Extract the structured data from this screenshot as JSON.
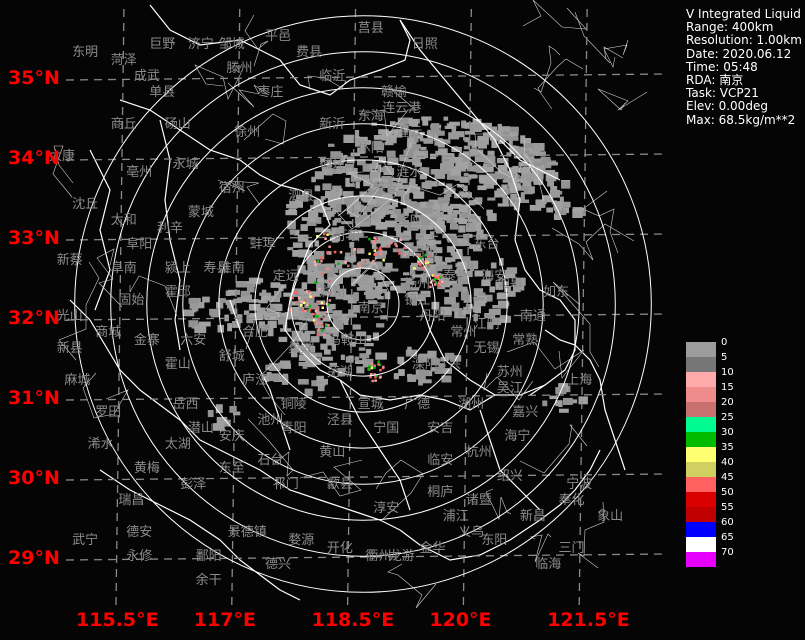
{
  "info": {
    "product": "V Integrated Liquid",
    "range": "Range: 400km",
    "resolution": "Resolution: 1.00km",
    "date": "Date: 2020.06.12",
    "time": "Time: 05:48",
    "rda": "RDA: 南京",
    "task": "Task: VCP21",
    "elev": "Elev: 0.00deg",
    "max": "Max: 68.5kg/m**2"
  },
  "lat_labels": [
    {
      "text": "35°N",
      "lat": 35
    },
    {
      "text": "34°N",
      "lat": 34
    },
    {
      "text": "33°N",
      "lat": 33
    },
    {
      "text": "32°N",
      "lat": 32
    },
    {
      "text": "31°N",
      "lat": 31
    },
    {
      "text": "30°N",
      "lat": 30
    },
    {
      "text": "29°N",
      "lat": 29
    }
  ],
  "lon_labels": [
    {
      "text": "115.5°E",
      "lon": 115.5
    },
    {
      "text": "117°E",
      "lon": 117
    },
    {
      "text": "118.5°E",
      "lon": 118.5
    },
    {
      "text": "120°E",
      "lon": 120
    },
    {
      "text": "121.5°E",
      "lon": 121.5
    }
  ],
  "legend": [
    {
      "label": "0",
      "color": "#9c9c9c"
    },
    {
      "label": "5",
      "color": "#767676"
    },
    {
      "label": "10",
      "color": "#ffaaaa"
    },
    {
      "label": "15",
      "color": "#ee8c8c"
    },
    {
      "label": "20",
      "color": "#c97070"
    },
    {
      "label": "25",
      "color": "#00fb90"
    },
    {
      "label": "30",
      "color": "#00bb00"
    },
    {
      "label": "35",
      "color": "#ffff70"
    },
    {
      "label": "40",
      "color": "#d0d060"
    },
    {
      "label": "45",
      "color": "#ff6060"
    },
    {
      "label": "50",
      "color": "#da0000"
    },
    {
      "label": "55",
      "color": "#c00000"
    },
    {
      "label": "60",
      "color": "#0000ff"
    },
    {
      "label": "65",
      "color": "#ffffff"
    },
    {
      "label": "70",
      "color": "#e800ff"
    }
  ],
  "radar": {
    "name": "南京",
    "lon": 118.7,
    "lat": 32.2,
    "ring_count": 8,
    "ring_spacing_km": 50
  },
  "cities": [
    {
      "name": "东明",
      "lon": 115.1,
      "lat": 35.3
    },
    {
      "name": "菏泽",
      "lon": 115.6,
      "lat": 35.2
    },
    {
      "name": "巨野",
      "lon": 116.1,
      "lat": 35.4
    },
    {
      "name": "济宁",
      "lon": 116.6,
      "lat": 35.4
    },
    {
      "name": "邹城",
      "lon": 117.0,
      "lat": 35.4
    },
    {
      "name": "平邑",
      "lon": 117.6,
      "lat": 35.5
    },
    {
      "name": "费县",
      "lon": 118.0,
      "lat": 35.3
    },
    {
      "name": "莒县",
      "lon": 118.8,
      "lat": 35.6
    },
    {
      "name": "日照",
      "lon": 119.5,
      "lat": 35.4
    },
    {
      "name": "成武",
      "lon": 115.9,
      "lat": 35.0
    },
    {
      "name": "单县",
      "lon": 116.1,
      "lat": 34.8
    },
    {
      "name": "滕州",
      "lon": 117.1,
      "lat": 35.1
    },
    {
      "name": "枣庄",
      "lon": 117.5,
      "lat": 34.8
    },
    {
      "name": "临沂",
      "lon": 118.3,
      "lat": 35.0
    },
    {
      "name": "赣榆",
      "lon": 119.1,
      "lat": 34.8
    },
    {
      "name": "砀山",
      "lon": 116.3,
      "lat": 34.4
    },
    {
      "name": "徐州",
      "lon": 117.2,
      "lat": 34.3
    },
    {
      "name": "新沂",
      "lon": 118.3,
      "lat": 34.4
    },
    {
      "name": "东海",
      "lon": 118.8,
      "lat": 34.5
    },
    {
      "name": "连云港",
      "lon": 119.2,
      "lat": 34.6
    },
    {
      "name": "商丘",
      "lon": 115.6,
      "lat": 34.4
    },
    {
      "name": "永城",
      "lon": 116.4,
      "lat": 33.9
    },
    {
      "name": "宿州",
      "lon": 117.0,
      "lat": 33.6
    },
    {
      "name": "宿迁",
      "lon": 118.3,
      "lat": 33.9
    },
    {
      "name": "沭阳",
      "lon": 118.8,
      "lat": 34.1
    },
    {
      "name": "灌云",
      "lon": 119.3,
      "lat": 34.3
    },
    {
      "name": "太康",
      "lon": 114.8,
      "lat": 34.0
    },
    {
      "name": "亳州",
      "lon": 115.8,
      "lat": 33.8
    },
    {
      "name": "蒙城",
      "lon": 116.6,
      "lat": 33.3
    },
    {
      "name": "泗县",
      "lon": 117.9,
      "lat": 33.5
    },
    {
      "name": "淮安",
      "lon": 119.0,
      "lat": 33.6
    },
    {
      "name": "涟水",
      "lon": 119.3,
      "lat": 33.8
    },
    {
      "name": "沈丘",
      "lon": 115.1,
      "lat": 33.4
    },
    {
      "name": "太和",
      "lon": 115.6,
      "lat": 33.2
    },
    {
      "name": "利辛",
      "lon": 116.2,
      "lat": 33.1
    },
    {
      "name": "蚌埠",
      "lon": 117.4,
      "lat": 32.9
    },
    {
      "name": "盱眙",
      "lon": 118.5,
      "lat": 33.0
    },
    {
      "name": "宝应",
      "lon": 119.3,
      "lat": 33.2
    },
    {
      "name": "阜阳",
      "lon": 115.8,
      "lat": 32.9
    },
    {
      "name": "颍上",
      "lon": 116.3,
      "lat": 32.6
    },
    {
      "name": "淮南",
      "lon": 117.0,
      "lat": 32.6
    },
    {
      "name": "滁州",
      "lon": 118.3,
      "lat": 32.3
    },
    {
      "name": "高邮",
      "lon": 119.5,
      "lat": 32.8
    },
    {
      "name": "东台",
      "lon": 120.3,
      "lat": 32.9
    },
    {
      "name": "新蔡",
      "lon": 114.9,
      "lat": 32.7
    },
    {
      "name": "阜南",
      "lon": 115.6,
      "lat": 32.6
    },
    {
      "name": "寿县",
      "lon": 116.8,
      "lat": 32.6
    },
    {
      "name": "定远",
      "lon": 117.7,
      "lat": 32.5
    },
    {
      "name": "扬州",
      "lon": 119.4,
      "lat": 32.4
    },
    {
      "name": "泰州",
      "lon": 119.9,
      "lat": 32.5
    },
    {
      "name": "海安",
      "lon": 120.4,
      "lat": 32.5
    },
    {
      "name": "如皋",
      "lon": 120.6,
      "lat": 32.4
    },
    {
      "name": "光山",
      "lon": 114.9,
      "lat": 32.0
    },
    {
      "name": "固始",
      "lon": 115.7,
      "lat": 32.2
    },
    {
      "name": "霍邱",
      "lon": 116.3,
      "lat": 32.3
    },
    {
      "name": "合肥",
      "lon": 117.3,
      "lat": 31.8
    },
    {
      "name": "南京",
      "lon": 118.8,
      "lat": 32.1
    },
    {
      "name": "镇江",
      "lon": 119.4,
      "lat": 32.2
    },
    {
      "name": "丹阳",
      "lon": 119.6,
      "lat": 32.0
    },
    {
      "name": "南通",
      "lon": 120.9,
      "lat": 32.0
    },
    {
      "name": "如东",
      "lon": 121.2,
      "lat": 32.3
    },
    {
      "name": "商城",
      "lon": 115.4,
      "lat": 31.8
    },
    {
      "name": "六安",
      "lon": 116.5,
      "lat": 31.7
    },
    {
      "name": "巢湖",
      "lon": 117.9,
      "lat": 31.6
    },
    {
      "name": "马鞍山",
      "lon": 118.5,
      "lat": 31.7
    },
    {
      "name": "常州",
      "lon": 120.0,
      "lat": 31.8
    },
    {
      "name": "江阴",
      "lon": 120.3,
      "lat": 31.9
    },
    {
      "name": "新县",
      "lon": 114.9,
      "lat": 31.6
    },
    {
      "name": "金寨",
      "lon": 115.9,
      "lat": 31.7
    },
    {
      "name": "舒城",
      "lon": 117.0,
      "lat": 31.5
    },
    {
      "name": "芜湖",
      "lon": 118.4,
      "lat": 31.3
    },
    {
      "name": "溧阳",
      "lon": 119.5,
      "lat": 31.4
    },
    {
      "name": "无锡",
      "lon": 120.3,
      "lat": 31.6
    },
    {
      "name": "常熟",
      "lon": 120.8,
      "lat": 31.7
    },
    {
      "name": "霍山",
      "lon": 116.3,
      "lat": 31.4
    },
    {
      "name": "庐江",
      "lon": 117.3,
      "lat": 31.2
    },
    {
      "name": "宣城",
      "lon": 118.8,
      "lat": 30.9
    },
    {
      "name": "宜兴",
      "lon": 119.8,
      "lat": 31.4
    },
    {
      "name": "苏州",
      "lon": 120.6,
      "lat": 31.3
    },
    {
      "name": "上海",
      "lon": 121.5,
      "lat": 31.2
    },
    {
      "name": "麻城",
      "lon": 115.0,
      "lat": 31.2
    },
    {
      "name": "岳西",
      "lon": 116.4,
      "lat": 30.9
    },
    {
      "name": "铜陵",
      "lon": 117.8,
      "lat": 30.9
    },
    {
      "name": "广德",
      "lon": 119.4,
      "lat": 30.9
    },
    {
      "name": "湖州",
      "lon": 120.1,
      "lat": 30.9
    },
    {
      "name": "吴江",
      "lon": 120.6,
      "lat": 31.1
    },
    {
      "name": "罗田",
      "lon": 115.4,
      "lat": 30.8
    },
    {
      "name": "潜山",
      "lon": 116.6,
      "lat": 30.6
    },
    {
      "name": "池州",
      "lon": 117.5,
      "lat": 30.7
    },
    {
      "name": "泾县",
      "lon": 118.4,
      "lat": 30.7
    },
    {
      "name": "安吉",
      "lon": 119.7,
      "lat": 30.6
    },
    {
      "name": "嘉兴",
      "lon": 120.8,
      "lat": 30.8
    },
    {
      "name": "浠水",
      "lon": 115.3,
      "lat": 30.4
    },
    {
      "name": "太湖",
      "lon": 116.3,
      "lat": 30.4
    },
    {
      "name": "安庆",
      "lon": 117.0,
      "lat": 30.5
    },
    {
      "name": "青阳",
      "lon": 117.8,
      "lat": 30.6
    },
    {
      "name": "宁国",
      "lon": 119.0,
      "lat": 30.6
    },
    {
      "name": "杭州",
      "lon": 120.2,
      "lat": 30.3
    },
    {
      "name": "海宁",
      "lon": 120.7,
      "lat": 30.5
    },
    {
      "name": "黄梅",
      "lon": 115.9,
      "lat": 30.1
    },
    {
      "name": "东至",
      "lon": 117.0,
      "lat": 30.1
    },
    {
      "name": "石台",
      "lon": 117.5,
      "lat": 30.2
    },
    {
      "name": "黄山",
      "lon": 118.3,
      "lat": 30.3
    },
    {
      "name": "临安",
      "lon": 119.7,
      "lat": 30.2
    },
    {
      "name": "绍兴",
      "lon": 120.6,
      "lat": 30.0
    },
    {
      "name": "宁波",
      "lon": 121.5,
      "lat": 29.9
    },
    {
      "name": "瑞昌",
      "lon": 115.7,
      "lat": 29.7
    },
    {
      "name": "彭泽",
      "lon": 116.5,
      "lat": 29.9
    },
    {
      "name": "祁门",
      "lon": 117.7,
      "lat": 29.9
    },
    {
      "name": "歙县",
      "lon": 118.4,
      "lat": 29.9
    },
    {
      "name": "桐庐",
      "lon": 119.7,
      "lat": 29.8
    },
    {
      "name": "诸暨",
      "lon": 120.2,
      "lat": 29.7
    },
    {
      "name": "奉化",
      "lon": 121.4,
      "lat": 29.7
    },
    {
      "name": "德安",
      "lon": 115.8,
      "lat": 29.3
    },
    {
      "name": "景德镇",
      "lon": 117.2,
      "lat": 29.3
    },
    {
      "name": "婺源",
      "lon": 117.9,
      "lat": 29.2
    },
    {
      "name": "淳安",
      "lon": 119.0,
      "lat": 29.6
    },
    {
      "name": "浦江",
      "lon": 119.9,
      "lat": 29.5
    },
    {
      "name": "新昌",
      "lon": 120.9,
      "lat": 29.5
    },
    {
      "name": "象山",
      "lon": 121.9,
      "lat": 29.5
    },
    {
      "name": "武宁",
      "lon": 115.1,
      "lat": 29.2
    },
    {
      "name": "鄱阳",
      "lon": 116.7,
      "lat": 29.0
    },
    {
      "name": "开化",
      "lon": 118.4,
      "lat": 29.1
    },
    {
      "name": "衢州",
      "lon": 118.9,
      "lat": 29.0
    },
    {
      "name": "义乌",
      "lon": 120.1,
      "lat": 29.3
    },
    {
      "name": "东阳",
      "lon": 120.4,
      "lat": 29.2
    },
    {
      "name": "三门",
      "lon": 121.4,
      "lat": 29.1
    },
    {
      "name": "永修",
      "lon": 115.8,
      "lat": 29.0
    },
    {
      "name": "余干",
      "lon": 116.7,
      "lat": 28.7
    },
    {
      "name": "德兴",
      "lon": 117.6,
      "lat": 28.9
    },
    {
      "name": "龙游",
      "lon": 119.2,
      "lat": 29.0
    },
    {
      "name": "金华",
      "lon": 119.6,
      "lat": 29.1
    },
    {
      "name": "临海",
      "lon": 121.1,
      "lat": 28.9
    }
  ]
}
